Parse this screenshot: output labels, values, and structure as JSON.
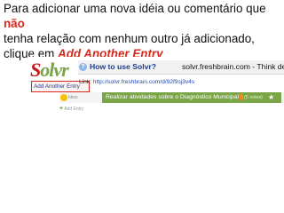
{
  "caption": {
    "part1": "Para adicionar uma nova idéia ou comentário que ",
    "highlight": "não",
    "line2": "tenha relação com nenhum outro já adicionado,",
    "part3": "clique em ",
    "link_text": "Add Another Entry"
  },
  "screenshot": {
    "logo_s": "S",
    "logo_rest": "olvr",
    "add_entry_label": "Add Another Entry",
    "help_icon": "question-icon",
    "title": "How to use Solvr?",
    "site": "solvr.freshbrain.com - Think deepe",
    "link_label": "Link:",
    "link_url": "http://solvr.freshbrain.com/d/92f9sj3v4s",
    "idea_label": "Idea:",
    "idea_text": "Realizar atividades sobre o Diagnóstico Municipal",
    "votes": "(5 votes)",
    "add_small_label": "Add Entry",
    "colors": {
      "accent_red": "#d92a1e",
      "idea_green": "#7aa647",
      "link_blue": "#1f48b0"
    }
  }
}
